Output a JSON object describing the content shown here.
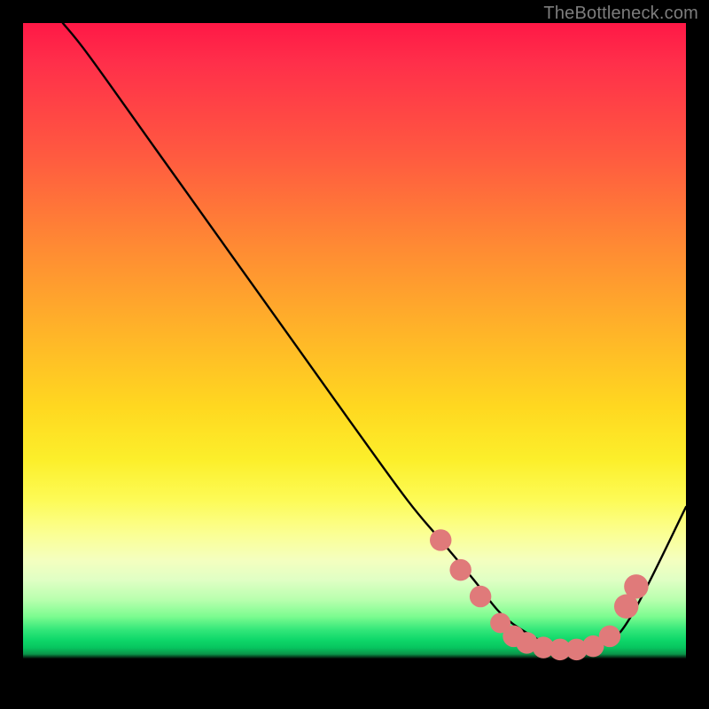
{
  "watermark": "TheBottleneck.com",
  "chart_data": {
    "type": "line",
    "title": "",
    "xlabel": "",
    "ylabel": "",
    "xlim": [
      0,
      100
    ],
    "ylim": [
      0,
      100
    ],
    "grid": false,
    "legend_position": "none",
    "series": [
      {
        "name": "curve",
        "x": [
          6,
          10,
          20,
          30,
          40,
          50,
          58,
          63,
          68,
          72,
          76,
          80,
          84,
          88,
          92,
          100
        ],
        "y": [
          100,
          95,
          81,
          67,
          53,
          39,
          28,
          22,
          16,
          11,
          8,
          6,
          5.5,
          6.5,
          11,
          27
        ],
        "color": "#000000"
      }
    ],
    "markers": [
      {
        "x": 63,
        "y": 22,
        "r": 1.1,
        "color": "#e07a7a"
      },
      {
        "x": 66,
        "y": 17.5,
        "r": 1.1,
        "color": "#e07a7a"
      },
      {
        "x": 69,
        "y": 13.5,
        "r": 1.1,
        "color": "#e07a7a"
      },
      {
        "x": 72,
        "y": 9.5,
        "r": 1.0,
        "color": "#e07a7a"
      },
      {
        "x": 74,
        "y": 7.5,
        "r": 1.1,
        "color": "#e07a7a"
      },
      {
        "x": 76,
        "y": 6.5,
        "r": 1.1,
        "color": "#e07a7a"
      },
      {
        "x": 78.5,
        "y": 5.8,
        "r": 1.1,
        "color": "#e07a7a"
      },
      {
        "x": 81,
        "y": 5.5,
        "r": 1.1,
        "color": "#e07a7a"
      },
      {
        "x": 83.5,
        "y": 5.5,
        "r": 1.1,
        "color": "#e07a7a"
      },
      {
        "x": 86,
        "y": 6,
        "r": 1.1,
        "color": "#e07a7a"
      },
      {
        "x": 88.5,
        "y": 7.5,
        "r": 1.1,
        "color": "#e07a7a"
      },
      {
        "x": 91,
        "y": 12,
        "r": 1.3,
        "color": "#e07a7a"
      },
      {
        "x": 92.5,
        "y": 15,
        "r": 1.3,
        "color": "#e07a7a"
      }
    ],
    "gradient_stops": [
      {
        "pos": 0,
        "color": "#ff1846"
      },
      {
        "pos": 0.34,
        "color": "#ff8b33"
      },
      {
        "pos": 0.66,
        "color": "#fcef2b"
      },
      {
        "pos": 0.93,
        "color": "#0fd86a"
      },
      {
        "pos": 0.959,
        "color": "#000000"
      }
    ]
  }
}
